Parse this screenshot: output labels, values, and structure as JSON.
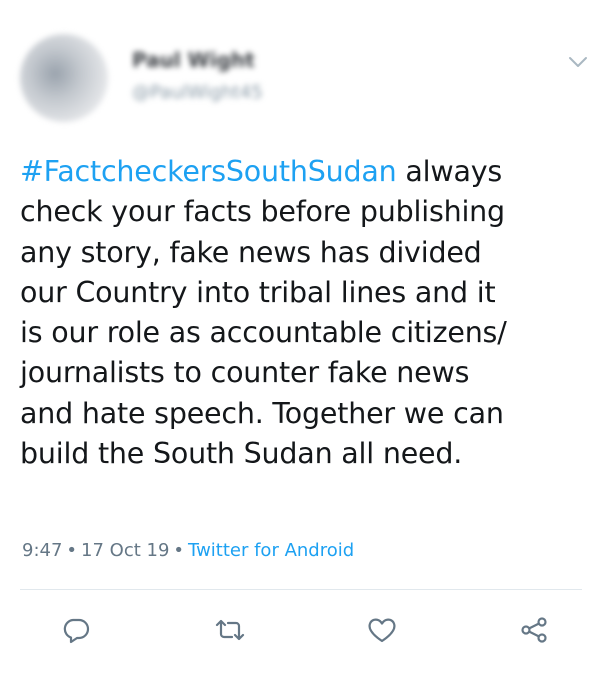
{
  "author": {
    "name": "Paul Wight",
    "handle": "@PaulWight45"
  },
  "tweet": {
    "hashtag": "#FactcheckersSouthSudan",
    "body": " always\ncheck your facts before publishing\nany story, fake news has divided\nour Country into tribal lines and it\nis our role as accountable citizens/\njournalists to counter fake news\nand hate speech. Together we can\nbuild the South Sudan all need."
  },
  "meta": {
    "time": "9:47",
    "date": "17 Oct 19",
    "source": "Twitter for Android",
    "separator": "•"
  },
  "actions": [
    "reply-icon",
    "retweet-icon",
    "like-icon",
    "share-icon"
  ],
  "colors": {
    "link": "#1da1f2",
    "icon": "#657786",
    "text": "#14171a"
  }
}
